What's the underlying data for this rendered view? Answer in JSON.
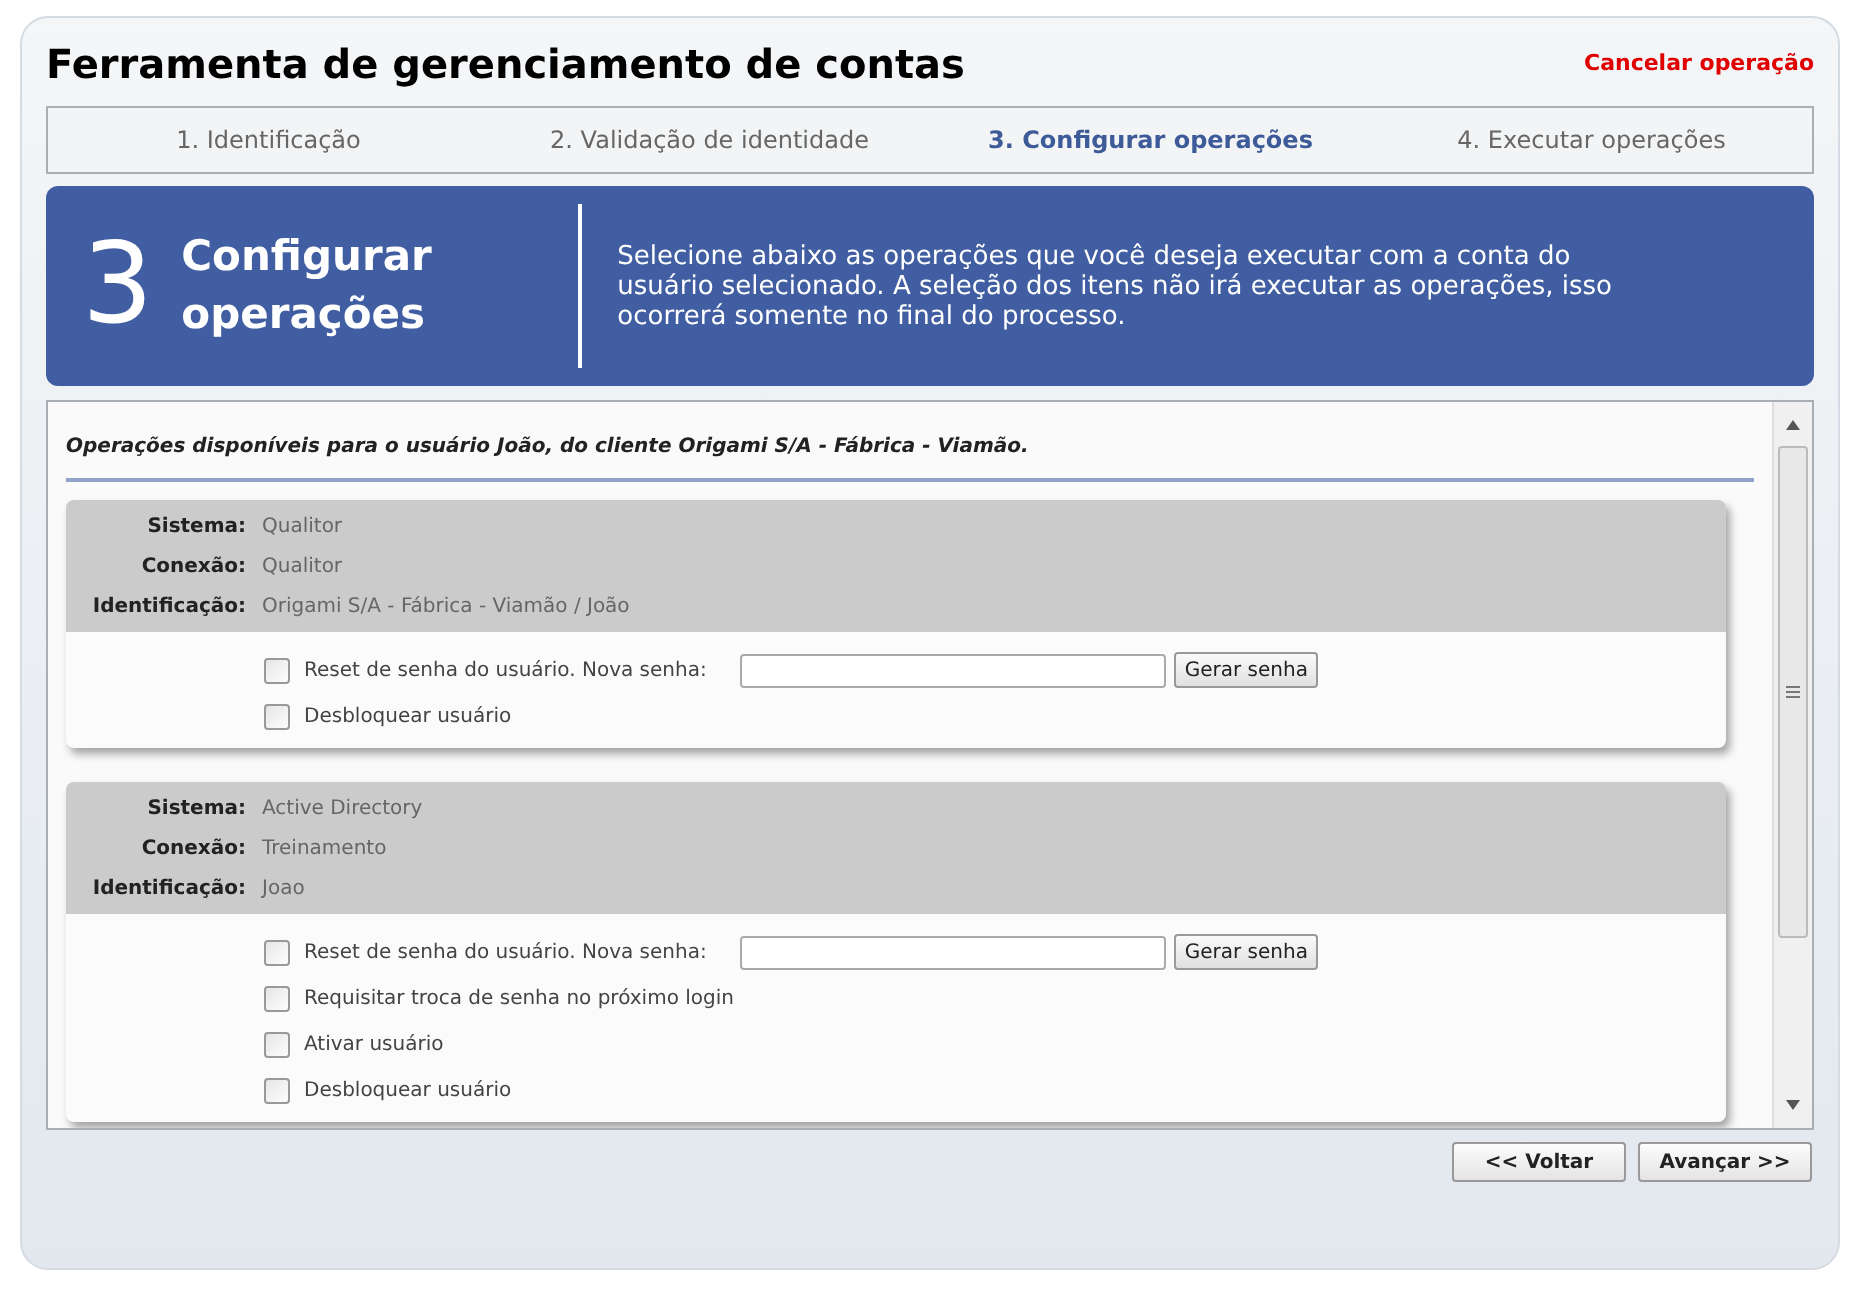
{
  "title": "Ferramenta de gerenciamento de contas",
  "cancel_link": "Cancelar operação",
  "steps": [
    {
      "label": "1. Identificação",
      "selected": false
    },
    {
      "label": "2. Validação de identidade",
      "selected": false
    },
    {
      "label": "3. Configurar operações",
      "selected": true
    },
    {
      "label": "4. Executar operações",
      "selected": false
    }
  ],
  "banner": {
    "number": "3",
    "heading": "Configurar operações",
    "description": "Selecione abaixo as operações que você deseja executar com a conta do usuário selecionado. A seleção dos itens não irá executar as operações, isso ocorrerá somente no final do processo."
  },
  "section_title": "Operações disponíveis para o usuário João, do cliente Origami S/A - Fábrica - Viamão.",
  "systems": [
    {
      "details": [
        {
          "label": "Sistema:",
          "value": "Qualitor"
        },
        {
          "label": "Conexão:",
          "value": "Qualitor"
        },
        {
          "label": "Identificação:",
          "value": "Origami S/A - Fábrica - Viamão / João"
        }
      ],
      "options": [
        {
          "kind": "password",
          "label": "Reset de senha do usuário. Nova senha:",
          "checked": false,
          "button": "Gerar senha"
        },
        {
          "kind": "checkbox",
          "label": "Desbloquear usuário",
          "checked": false
        }
      ]
    },
    {
      "details": [
        {
          "label": "Sistema:",
          "value": "Active Directory"
        },
        {
          "label": "Conexão:",
          "value": "Treinamento"
        },
        {
          "label": "Identificação:",
          "value": "Joao"
        }
      ],
      "options": [
        {
          "kind": "password",
          "label": "Reset de senha do usuário. Nova senha:",
          "checked": false,
          "button": "Gerar senha"
        },
        {
          "kind": "checkbox",
          "label": "Requisitar troca de senha no próximo login",
          "checked": false
        },
        {
          "kind": "checkbox",
          "label": "Ativar usuário",
          "checked": false
        },
        {
          "kind": "checkbox",
          "label": "Desbloquear usuário",
          "checked": false
        }
      ]
    }
  ],
  "buttons": [
    "<< Voltar",
    "Avançar >>"
  ]
}
